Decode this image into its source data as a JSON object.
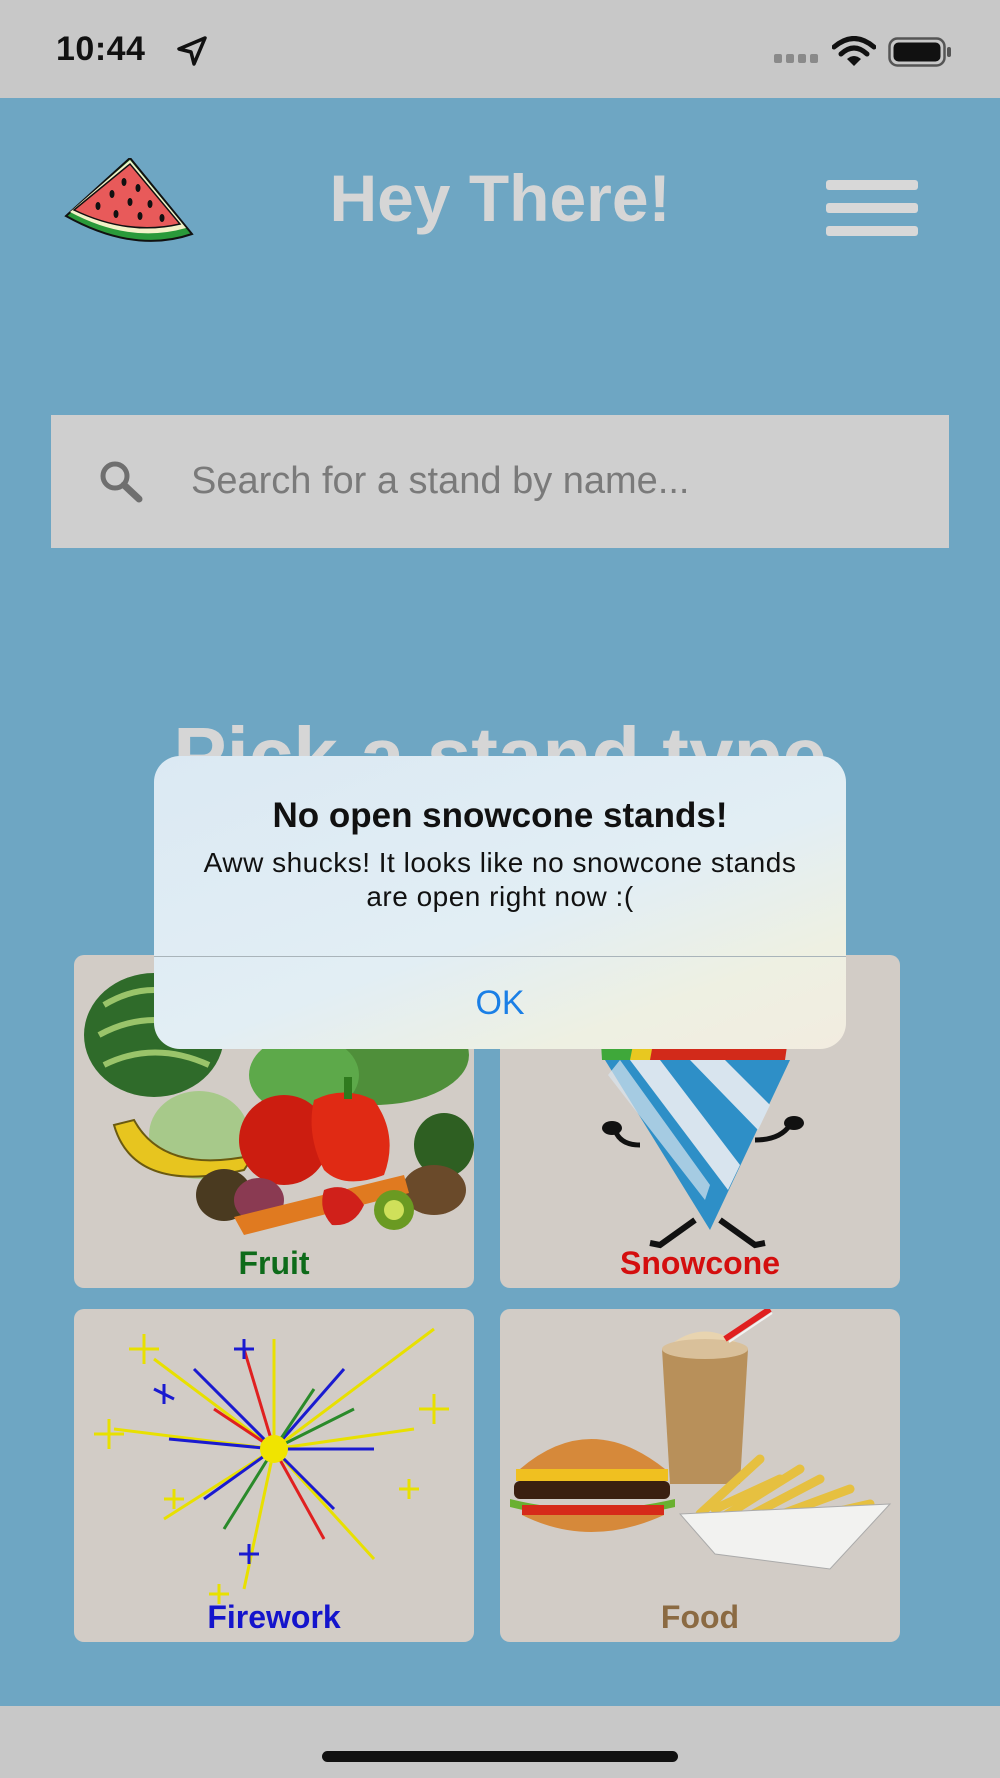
{
  "status_bar": {
    "time": "10:44",
    "icons": [
      "location-arrow-icon",
      "cellular-signal-icon",
      "wifi-icon",
      "battery-icon"
    ]
  },
  "header": {
    "logo": "watermelon-slice-icon",
    "title": "Hey There!",
    "menu_icon": "hamburger-menu-icon"
  },
  "search": {
    "icon": "search-icon",
    "placeholder": "Search for a stand by name..."
  },
  "section": {
    "title": "Pick a stand type"
  },
  "tiles": [
    {
      "label": "Fruit",
      "color": "#0e6b1a",
      "image": "fruit-vegetable-pile"
    },
    {
      "label": "Snowcone",
      "color": "#d40e0e",
      "image": "snowcone-character"
    },
    {
      "label": "Firework",
      "color": "#1414cc",
      "image": "firework-burst"
    },
    {
      "label": "Food",
      "color": "#8b6a42",
      "image": "burger-shake-fries"
    }
  ],
  "alert": {
    "title": "No open snowcone stands!",
    "message": "Aww shucks! It looks like no snowcone stands are open right now :(",
    "ok_label": "OK"
  },
  "colors": {
    "background": "#6ea6c3",
    "header_text": "#d6d6d6",
    "alert_button": "#1a7fe6"
  }
}
